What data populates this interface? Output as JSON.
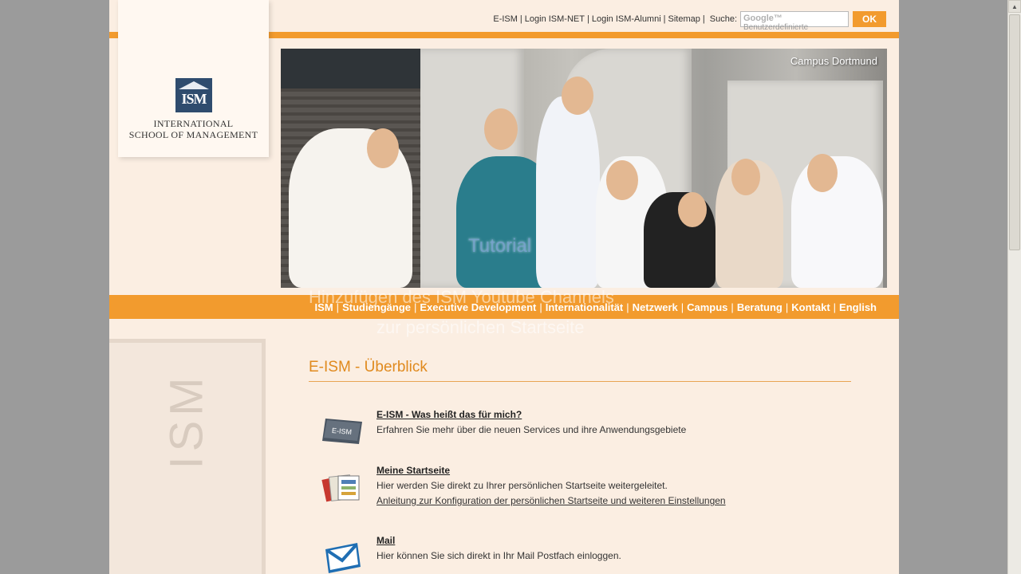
{
  "header": {
    "links": [
      "E-ISM",
      "Login ISM-NET",
      "Login ISM-Alumni",
      "Sitemap"
    ],
    "search_label": "Suche:",
    "search_brand": "Google™",
    "search_placeholder": "Benutzerdefinierte",
    "ok_label": "OK"
  },
  "logo": {
    "abbr": "ISM",
    "line1": "INTERNATIONAL",
    "line2": "SCHOOL OF MANAGEMENT"
  },
  "hero": {
    "caption": "Campus Dortmund",
    "overlay_text": "Tutorial"
  },
  "nav": {
    "items": [
      "ISM",
      "Studiengänge",
      "Executive Development",
      "Internationalität",
      "Netzwerk",
      "Campus",
      "Beratung",
      "Kontakt",
      "English"
    ]
  },
  "overlay": {
    "line1": "Hinzufügen des ISM Youtube Channels",
    "line2": "zur persönlichen Startseite"
  },
  "sidebar": {
    "watermark": "ISM"
  },
  "content": {
    "title": "E-ISM - Überblick",
    "items": [
      {
        "icon": "eism-card-icon",
        "title": "E-ISM - Was heißt das für mich?",
        "desc": "Erfahren Sie mehr über die neuen Services und ihre Anwendungsgebiete"
      },
      {
        "icon": "start-page-icon",
        "title": "Meine Startseite",
        "desc": "Hier werden Sie direkt zu Ihrer persönlichen Startseite weitergeleitet.",
        "link": "Anleitung zur Konfiguration der persönlichen Startseite und weiteren Einstellungen"
      },
      {
        "icon": "mail-icon",
        "title": "Mail",
        "desc": "Hier können Sie sich direkt in Ihr Mail Postfach einloggen."
      }
    ]
  },
  "colors": {
    "accent": "#f29b2e",
    "page_bg": "#fbeee2",
    "title": "#e08a1e",
    "logo_blue": "#2f4c6e"
  }
}
